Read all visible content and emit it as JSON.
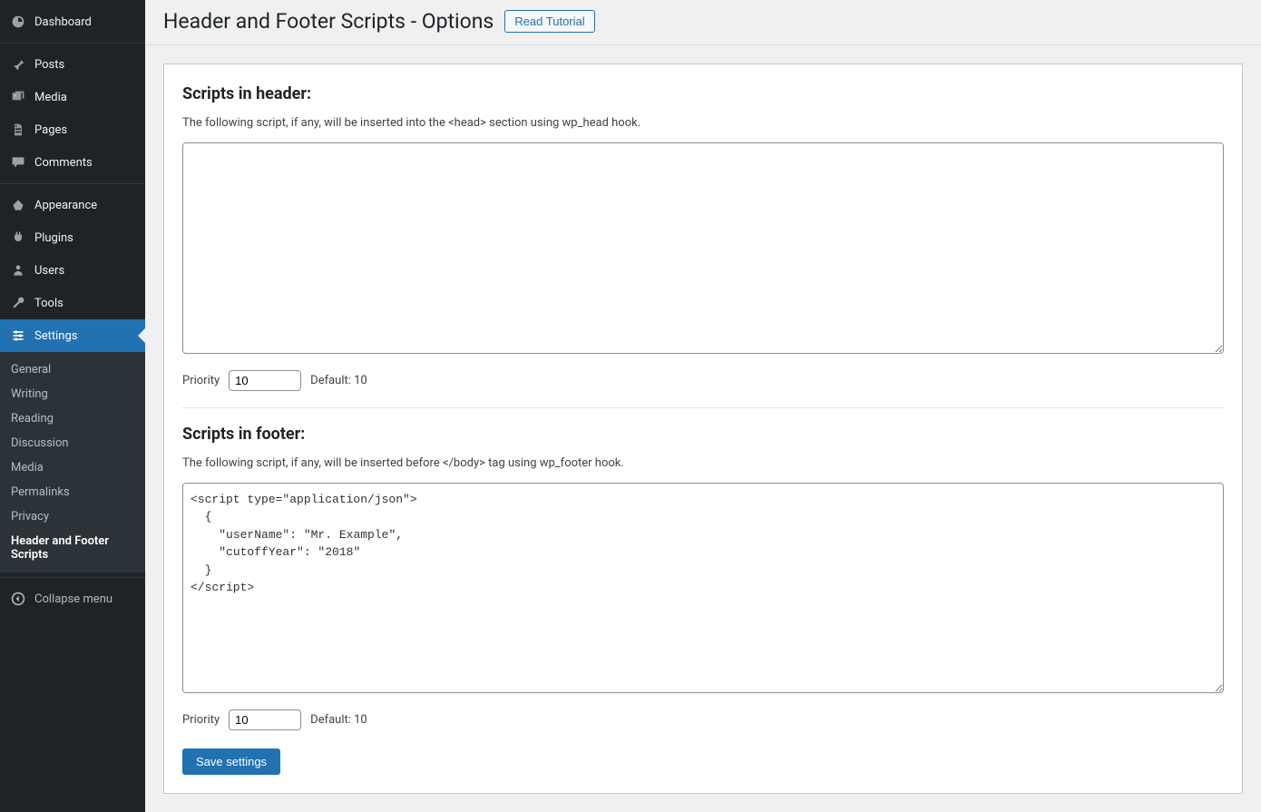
{
  "sidebar": {
    "items": [
      {
        "label": "Dashboard",
        "icon": "dashboard"
      },
      {
        "label": "Posts",
        "icon": "pin"
      },
      {
        "label": "Media",
        "icon": "media"
      },
      {
        "label": "Pages",
        "icon": "pages"
      },
      {
        "label": "Comments",
        "icon": "comments"
      },
      {
        "label": "Appearance",
        "icon": "appearance"
      },
      {
        "label": "Plugins",
        "icon": "plugins"
      },
      {
        "label": "Users",
        "icon": "users"
      },
      {
        "label": "Tools",
        "icon": "tools"
      },
      {
        "label": "Settings",
        "icon": "settings"
      }
    ],
    "submenu": [
      {
        "label": "General"
      },
      {
        "label": "Writing"
      },
      {
        "label": "Reading"
      },
      {
        "label": "Discussion"
      },
      {
        "label": "Media"
      },
      {
        "label": "Permalinks"
      },
      {
        "label": "Privacy"
      },
      {
        "label": "Header and Footer Scripts"
      }
    ],
    "collapse": "Collapse menu"
  },
  "header": {
    "title": "Header and Footer Scripts - Options",
    "tutorial": "Read Tutorial"
  },
  "sections": {
    "header_scripts": {
      "title": "Scripts in header:",
      "desc": "The following script, if any, will be inserted into the <head> section using wp_head hook.",
      "value": "",
      "priority_label": "Priority",
      "priority_value": "10",
      "default_label": "Default: 10"
    },
    "footer_scripts": {
      "title": "Scripts in footer:",
      "desc": "The following script, if any, will be inserted before </body> tag using wp_footer hook.",
      "value": "<script type=\"application/json\">\n  {\n    \"userName\": \"Mr. Example\",\n    \"cutoffYear\": \"2018\"\n  }\n</script>",
      "priority_label": "Priority",
      "priority_value": "10",
      "default_label": "Default: 10"
    }
  },
  "buttons": {
    "save": "Save settings"
  }
}
